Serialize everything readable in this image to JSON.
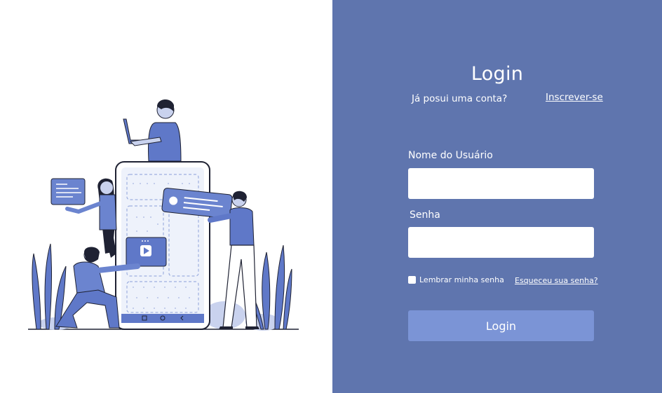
{
  "colors": {
    "panel_background": "#5f75ae",
    "accent": "#7b94d6",
    "text_on_panel": "#ffffff",
    "illustration_primary": "#5f78c8",
    "illustration_dark": "#1f2233"
  },
  "illustration": {
    "icon": "people-with-smartphone-illustration",
    "play_icon": "play-icon",
    "nav_icons": [
      "square-icon",
      "circle-icon",
      "back-chevron-icon"
    ]
  },
  "login": {
    "title": "Login",
    "has_account_text": "Já posui uma conta?",
    "signup_link": "Inscrever-se",
    "username_label": "Nome do Usuário",
    "username_value": "",
    "password_label": "Senha",
    "password_value": "",
    "remember_label": "Lembrar minha senha",
    "remember_checked": false,
    "forgot_link": "Esqueceu sua senha?",
    "submit_label": "Login"
  }
}
